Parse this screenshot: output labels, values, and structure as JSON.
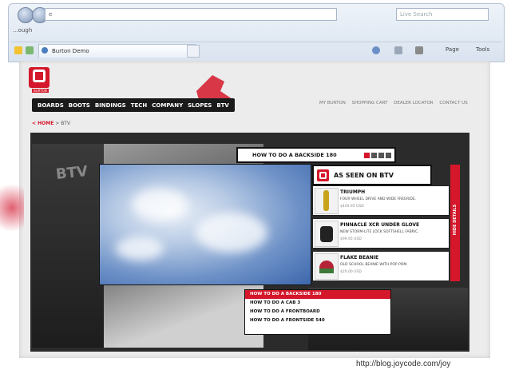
{
  "browser": {
    "address_placeholder": "e",
    "search_placeholder": "Live Search",
    "row2_text": "...ough",
    "tab_title": "Burton Demo",
    "tools": [
      "Page",
      "Tools"
    ]
  },
  "site": {
    "logo_text": "BURTON",
    "nav": [
      "BOARDS",
      "BOOTS",
      "BINDINGS",
      "TECH",
      "COMPANY",
      "SLOPES",
      "BTV"
    ],
    "top_links": [
      "MY BURTON",
      "SHOPPING CART",
      "DEALER LOCATOR",
      "CONTACT US"
    ],
    "breadcrumb": {
      "home": "< HOME",
      "sep": ">",
      "current": "BTV"
    }
  },
  "btv": {
    "left_logo": "BTV",
    "video_title": "HOW TO DO A BACKSIDE 180",
    "as_seen": "AS SEEN ON BTV",
    "side_tab": "HIDE DETAILS",
    "products": [
      {
        "name": "TRIUMPH",
        "desc": "FOUR WHEEL DRIVE AND WIDE FREERIDE.",
        "price": "$449.95 USD"
      },
      {
        "name": "PINNACLE XCR UNDER GLOVE",
        "desc": "NEW STORM-LITE LOCK SOFTSHELL FABRIC.",
        "price": "$99.95 USD"
      },
      {
        "name": "FLAKE BEANIE",
        "desc": "OLD SCHOOL BEANIE WITH POP POM.",
        "price": "$20.00 USD"
      }
    ],
    "howto_list": [
      "HOW TO DO A BACKSIDE 180",
      "HOW TO DO A CAB 3",
      "HOW TO DO A FRONTBOARD",
      "HOW TO DO A FRONTSIDE 540"
    ],
    "active_index": 0
  },
  "caption": "http://blog.joycode.com/joy",
  "colors": {
    "accent": "#d4172a",
    "dark": "#1a1a1a"
  }
}
